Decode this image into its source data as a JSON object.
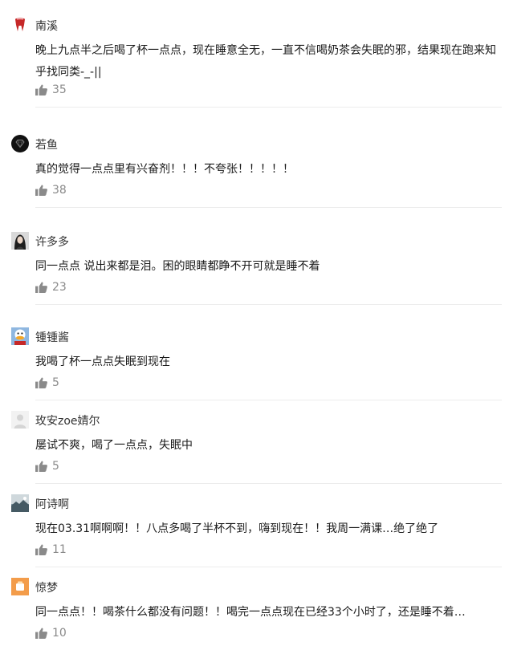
{
  "comments": [
    {
      "user": "南溪",
      "text": "晚上九点半之后喝了杯一点点，现在睡意全无，一直不信喝奶茶会失眠的邪，结果现在跑来知乎找同类-_-||",
      "likes": "35",
      "avatar_icon": "tooth-avatar"
    },
    {
      "user": "若鱼",
      "text": "真的觉得一点点里有兴奋剂！！！不夸张！！！！！",
      "likes": "38",
      "avatar_icon": "black-diamond-avatar"
    },
    {
      "user": "许多多",
      "text": "同一点点 说出来都是泪。困的眼睛都睁不开可就是睡不着",
      "likes": "23",
      "avatar_icon": "portrait-avatar"
    },
    {
      "user": "锺锺酱",
      "text": "我喝了杯一点点失眠到现在",
      "likes": "5",
      "avatar_icon": "cartoon-duck-avatar"
    },
    {
      "user": "玫安zoe婧尔",
      "text": "屡试不爽，喝了一点点，失眠中",
      "likes": "5",
      "avatar_icon": "default-avatar"
    },
    {
      "user": "阿诗啊",
      "text": "现在03.31啊啊啊！！八点多喝了半杯不到，嗨到现在！！我周一满课…绝了绝了",
      "likes": "11",
      "avatar_icon": "landscape-avatar"
    },
    {
      "user": "惊梦",
      "text": "同一点点！！喝茶什么都没有问题！！喝完一点点现在已经33个小时了，还是睡不着…",
      "likes": "10",
      "avatar_icon": "orange-avatar"
    }
  ],
  "colors": {
    "like": "#8a8a8a",
    "divider": "#ececec",
    "text": "#1a1a1a"
  }
}
